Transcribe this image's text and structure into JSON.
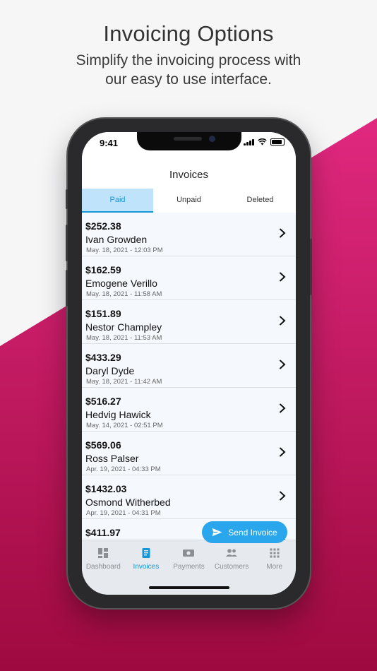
{
  "headline": "Invoicing Options",
  "subline": [
    "Simplify the invoicing process with",
    "our easy to use interface."
  ],
  "colors": {
    "accent": "#1796d6",
    "tab_active_bg": "#bfe3fa",
    "send_button": "#2aa6ec",
    "wedge_top": "#e0287f",
    "wedge_bottom": "#9e0a3f"
  },
  "status": {
    "time": "9:41",
    "icons": [
      "signal-icon",
      "wifi-icon",
      "battery-icon"
    ]
  },
  "nav": {
    "title": "Invoices"
  },
  "tabs": [
    {
      "label": "Paid",
      "active": true
    },
    {
      "label": "Unpaid",
      "active": false
    },
    {
      "label": "Deleted",
      "active": false
    }
  ],
  "invoices": [
    {
      "amount": "$252.38",
      "name": "Ivan Growden",
      "date": "May. 18, 2021 - 12:03 PM"
    },
    {
      "amount": "$162.59",
      "name": "Emogene Verillo",
      "date": "May. 18, 2021 - 11:58 AM"
    },
    {
      "amount": "$151.89",
      "name": "Nestor Champley",
      "date": "May. 18, 2021 - 11:53 AM"
    },
    {
      "amount": "$433.29",
      "name": "Daryl Dyde",
      "date": "May. 18, 2021 - 11:42 AM"
    },
    {
      "amount": "$516.27",
      "name": "Hedvig Hawick",
      "date": "May. 14, 2021 - 02:51 PM"
    },
    {
      "amount": "$569.06",
      "name": "Ross Palser",
      "date": "Apr. 19, 2021 - 04:33 PM"
    },
    {
      "amount": "$1432.03",
      "name": "Osmond Witherbed",
      "date": "Apr. 19, 2021 - 04:31 PM"
    },
    {
      "amount": "$411.97",
      "name": "",
      "date": ""
    }
  ],
  "send_button": {
    "label": "Send Invoice",
    "icon": "send-icon"
  },
  "tabbar": [
    {
      "label": "Dashboard",
      "icon": "dashboard-icon",
      "active": false
    },
    {
      "label": "Invoices",
      "icon": "invoice-icon",
      "active": true
    },
    {
      "label": "Payments",
      "icon": "payments-icon",
      "active": false
    },
    {
      "label": "Customers",
      "icon": "customers-icon",
      "active": false
    },
    {
      "label": "More",
      "icon": "grid-icon",
      "active": false
    }
  ]
}
